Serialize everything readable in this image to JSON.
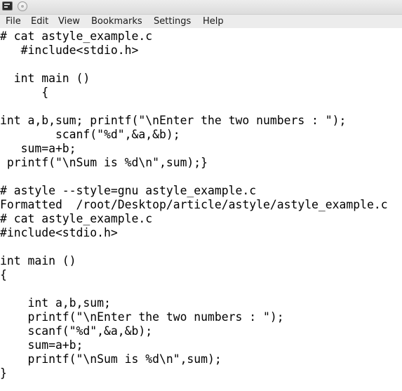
{
  "menu": {
    "file": "File",
    "edit": "Edit",
    "view": "View",
    "bookmarks": "Bookmarks",
    "settings": "Settings",
    "help": "Help"
  },
  "terminal": {
    "lines": [
      "# cat astyle_example.c",
      "   #include<stdio.h>",
      "",
      "  int main ()",
      "      {",
      "",
      "int a,b,sum; printf(\"\\nEnter the two numbers : \");",
      "        scanf(\"%d\",&a,&b);",
      "   sum=a+b;",
      " printf(\"\\nSum is %d\\n\",sum);}",
      "",
      "# astyle --style=gnu astyle_example.c",
      "Formatted  /root/Desktop/article/astyle/astyle_example.c",
      "# cat astyle_example.c",
      "#include<stdio.h>",
      "",
      "int main ()",
      "{",
      "",
      "    int a,b,sum;",
      "    printf(\"\\nEnter the two numbers : \");",
      "    scanf(\"%d\",&a,&b);",
      "    sum=a+b;",
      "    printf(\"\\nSum is %d\\n\",sum);",
      "}"
    ]
  }
}
